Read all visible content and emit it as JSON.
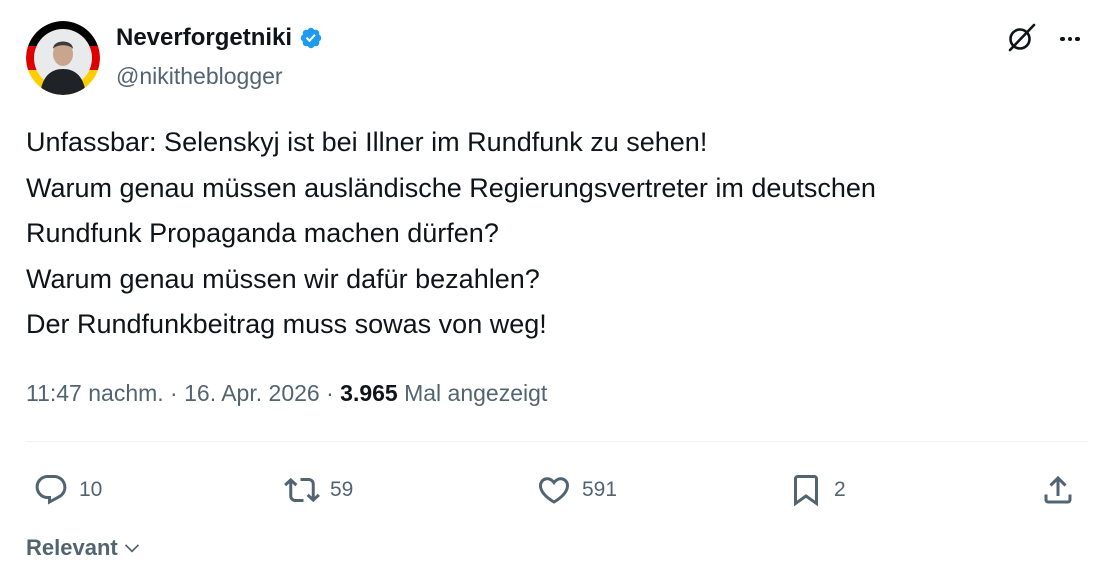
{
  "author": {
    "display_name": "Neverforgetniki",
    "handle": "@nikitheblogger",
    "verified": true
  },
  "header_icons": {
    "grok": "grok-icon",
    "more": "more-dots-icon"
  },
  "tweet": {
    "lines": [
      "Unfassbar: Selenskyj ist bei Illner im Rundfunk zu sehen!",
      "Warum genau müssen ausländische Regierungsvertreter im deutschen",
      "Rundfunk Propaganda machen dürfen?",
      "Warum genau müssen wir dafür bezahlen?",
      "Der Rundfunkbeitrag muss sowas von weg!"
    ],
    "time": "11:47 nachm.",
    "separator": " · ",
    "date": "16. Apr. 2026",
    "views": "3.965",
    "views_label": "Mal angezeigt"
  },
  "actions": {
    "replies": "10",
    "retweets": "59",
    "likes": "591",
    "bookmarks": "2"
  },
  "sort": {
    "label": "Relevant"
  },
  "colors": {
    "text": "#0f1419",
    "secondary": "#536471",
    "verified": "#1d9bf0",
    "divider": "#eff3f4"
  }
}
